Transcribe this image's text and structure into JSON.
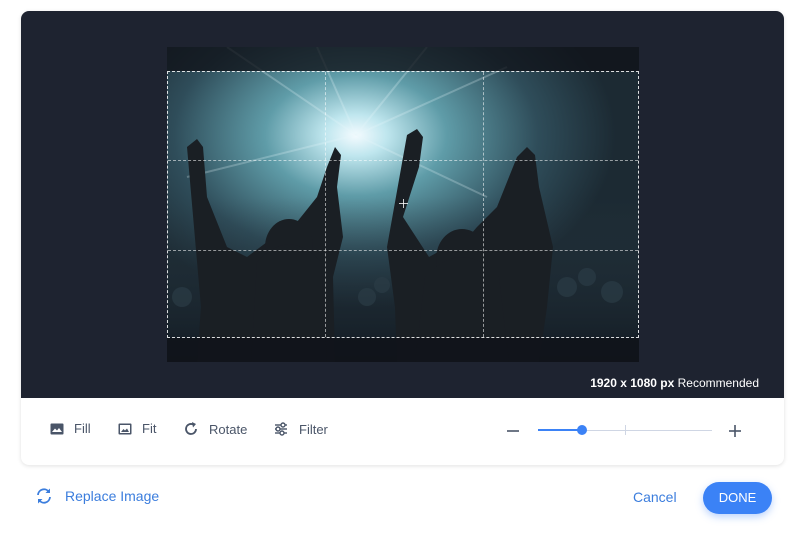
{
  "editor": {
    "size_value": "1920 x 1080 px",
    "size_note": "Recommended"
  },
  "toolbar": {
    "tools": [
      {
        "label": "Fill",
        "icon": "image-icon"
      },
      {
        "label": "Fit",
        "icon": "image-frame-icon"
      },
      {
        "label": "Rotate",
        "icon": "rotate-icon"
      },
      {
        "label": "Filter",
        "icon": "sliders-icon"
      }
    ],
    "zoom": {
      "level": 0.25,
      "minus_icon": "minus-icon",
      "plus_icon": "plus-icon"
    }
  },
  "footer": {
    "replace_label": "Replace Image",
    "replace_icon": "refresh-icon",
    "cancel_label": "Cancel",
    "done_label": "DONE"
  },
  "colors": {
    "accent": "#3b82f6",
    "link": "#3b7ddd",
    "stage": "#1e2330"
  }
}
